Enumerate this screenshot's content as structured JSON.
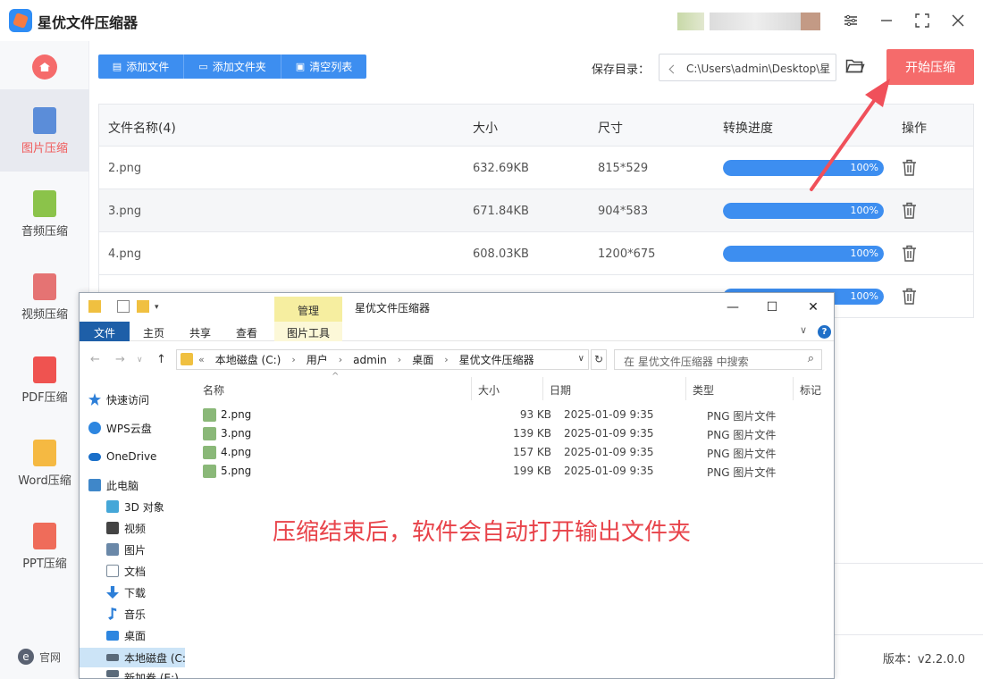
{
  "app": {
    "title": "星优文件压缩器"
  },
  "sidebar": {
    "items": [
      {
        "label": "图片压缩",
        "active": true,
        "color": "#5b8dd9"
      },
      {
        "label": "音频压缩",
        "active": false,
        "color": "#8bc34a"
      },
      {
        "label": "视频压缩",
        "active": false,
        "color": "#e57373"
      },
      {
        "label": "PDF压缩",
        "active": false,
        "color": "#ef5350"
      },
      {
        "label": "Word压缩",
        "active": false,
        "color": "#f5b942"
      },
      {
        "label": "PPT压缩",
        "active": false,
        "color": "#ef6c5a"
      }
    ],
    "footer_link": "官网",
    "footer_icon": "e"
  },
  "toolbar": {
    "add_file": "添加文件",
    "add_folder": "添加文件夹",
    "clear_list": "清空列表",
    "save_label": "保存目录：",
    "save_path": "C:\\Users\\admin\\Desktop\\星",
    "start": "开始压缩"
  },
  "table": {
    "headers": [
      "文件名称(4)",
      "大小",
      "尺寸",
      "转换进度",
      "操作"
    ],
    "rows": [
      {
        "name": "2.png",
        "size": "632.69KB",
        "dims": "815*529",
        "progress": 100,
        "progress_label": "100%"
      },
      {
        "name": "3.png",
        "size": "671.84KB",
        "dims": "904*583",
        "progress": 100,
        "progress_label": "100%"
      },
      {
        "name": "4.png",
        "size": "608.03KB",
        "dims": "1200*675",
        "progress": 100,
        "progress_label": "100%"
      },
      {
        "name": "",
        "size": "",
        "dims": "",
        "progress": 100,
        "progress_label": "100%"
      }
    ]
  },
  "status": {
    "version": "版本：v2.2.0.0"
  },
  "explorer": {
    "manage_tab": "管理",
    "title": "星优文件压缩器",
    "ribbon_tabs": [
      "文件",
      "主页",
      "共享",
      "查看",
      "图片工具"
    ],
    "help": "?",
    "address": [
      "«",
      "本地磁盘 (C:)",
      "用户",
      "admin",
      "桌面",
      "星优文件压缩器"
    ],
    "search_placeholder": "在 星优文件压缩器 中搜索",
    "nav_items": [
      {
        "label": "快速访问",
        "icon": "star-icon",
        "color": "#2d7fd8"
      },
      {
        "label": "WPS云盘",
        "icon": "cloud-icon",
        "color": "#2d86e0"
      },
      {
        "label": "OneDrive",
        "icon": "onedrive-icon",
        "color": "#1a6fc9"
      },
      {
        "label": "此电脑",
        "icon": "computer-icon",
        "color": "#3f87c9"
      },
      {
        "label": "3D 对象",
        "icon": "cube-icon",
        "color": "#45a7d8"
      },
      {
        "label": "视频",
        "icon": "film-icon",
        "color": "#444444"
      },
      {
        "label": "图片",
        "icon": "picture-icon",
        "color": "#6a88a8"
      },
      {
        "label": "文档",
        "icon": "document-icon",
        "color": "#7a8a9a"
      },
      {
        "label": "下载",
        "icon": "download-icon",
        "color": "#2d7fd8"
      },
      {
        "label": "音乐",
        "icon": "music-icon",
        "color": "#2d7fd8"
      },
      {
        "label": "桌面",
        "icon": "desktop-icon",
        "color": "#2d86e0"
      },
      {
        "label": "本地磁盘 (C:",
        "icon": "drive-icon",
        "color": "#5a6a7a"
      },
      {
        "label": "新加卷 (E:)",
        "icon": "drive-icon",
        "color": "#5a6a7a"
      }
    ],
    "columns": [
      "名称",
      "大小",
      "日期",
      "类型",
      "标记"
    ],
    "files": [
      {
        "name": "2.png",
        "size": "93 KB",
        "date": "2025-01-09 9:35",
        "type": "PNG 图片文件"
      },
      {
        "name": "3.png",
        "size": "139 KB",
        "date": "2025-01-09 9:35",
        "type": "PNG 图片文件"
      },
      {
        "name": "4.png",
        "size": "157 KB",
        "date": "2025-01-09 9:35",
        "type": "PNG 图片文件"
      },
      {
        "name": "5.png",
        "size": "199 KB",
        "date": "2025-01-09 9:35",
        "type": "PNG 图片文件"
      }
    ]
  },
  "annotation": {
    "caption": "压缩结束后，软件会自动打开输出文件夹",
    "color": "#e8434a"
  }
}
